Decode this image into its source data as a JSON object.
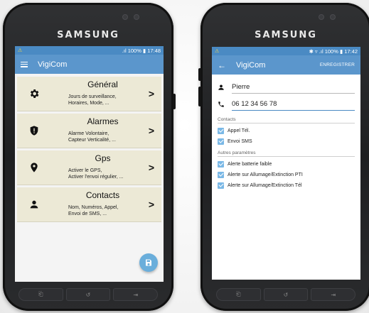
{
  "left_phone": {
    "brand": "SAMSUNG",
    "status": {
      "signal": ".ıl 100%",
      "battery": "▮",
      "time": "17:48",
      "alert": "⚠"
    },
    "appbar": {
      "title": "VigiCom",
      "menu_icon": "menu-icon"
    },
    "cards": [
      {
        "title": "Général",
        "description": "Jours de surveillance,\nHoraires, Mode, ...",
        "icon": "gear-icon"
      },
      {
        "title": "Alarmes",
        "description": "Alarme Volontaire,\nCapteur Verticalité, ...",
        "icon": "shield-alert-icon"
      },
      {
        "title": "Gps",
        "description": "Activer le GPS,\nActiver l'envoi régulier, ...",
        "icon": "location-pin-icon"
      },
      {
        "title": "Contacts",
        "description": "Nom, Numéros, Appel,\nEnvoi de SMS, ...",
        "icon": "person-icon"
      }
    ],
    "chevron": ">",
    "fab_icon": "save-icon",
    "navbar": [
      "⎗",
      "↺",
      "⇥"
    ]
  },
  "right_phone": {
    "brand": "SAMSUNG",
    "status": {
      "icons": "✱ ▿ .ıl 100%",
      "battery": "▮",
      "time": "17:42",
      "alert": "⚠"
    },
    "appbar": {
      "back": "←",
      "title": "VigiCom",
      "save": "ENREGISTRER"
    },
    "name_value": "Pierre",
    "phone_value": "06 12 34 56 78",
    "contacts_label": "Contacts",
    "contacts_options": [
      {
        "label": "Appel Tél.",
        "checked": true
      },
      {
        "label": "Envoi SMS",
        "checked": true
      }
    ],
    "other_label": "Autres paramètres",
    "other_options": [
      {
        "label": "Alerte batterie faible",
        "checked": true
      },
      {
        "label": "Alerte sur Allumage/Extinction PTI",
        "checked": true
      },
      {
        "label": "Alerte sur Allumage/Extinction Tél",
        "checked": true
      }
    ],
    "navbar": [
      "⎗",
      "↺",
      "⇥"
    ]
  },
  "colors": {
    "appbar": "#5b96cc",
    "statusbar": "#4a8ac3",
    "card": "#ece9d6",
    "checkbox": "#7ab8e6",
    "fab": "#6aaedb"
  }
}
